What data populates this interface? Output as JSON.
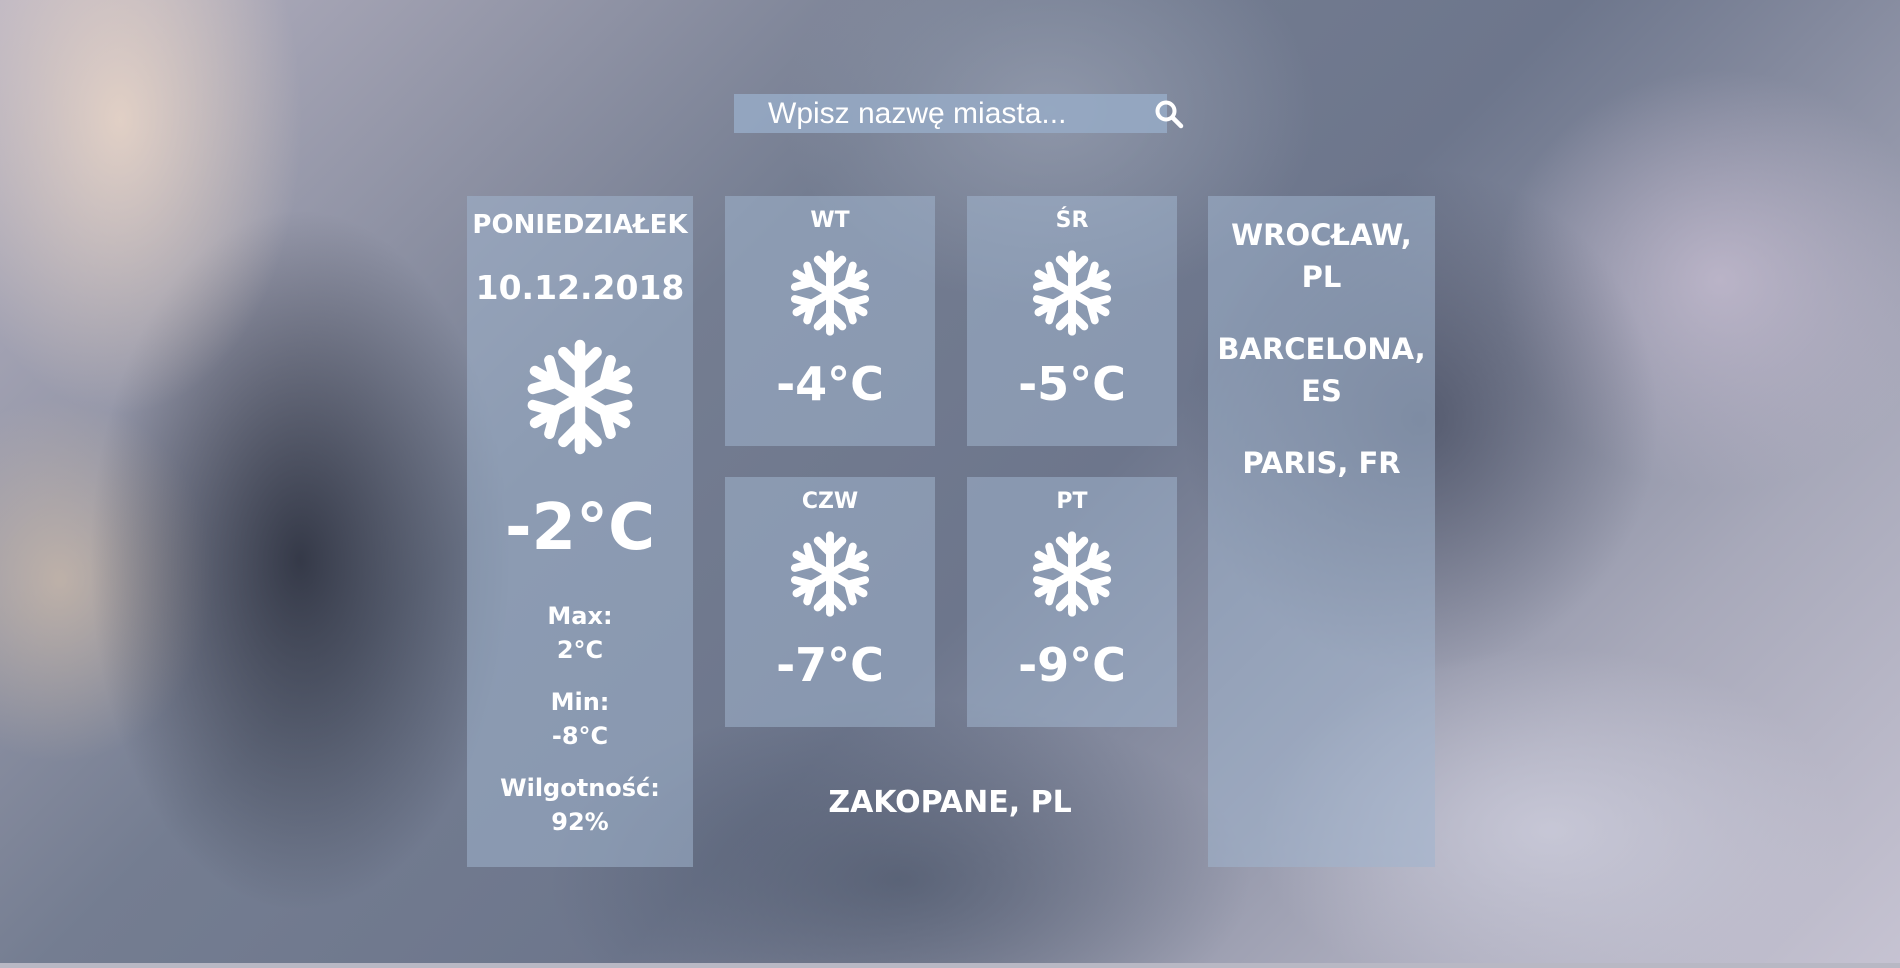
{
  "search": {
    "placeholder": "Wpisz nazwę miasta...",
    "button_icon": "search-icon"
  },
  "today": {
    "day": "PONIEDZIAŁEK",
    "date": "10.12.2018",
    "icon": "snowflake-icon",
    "temp": "-2°C",
    "max_label": "Max:",
    "max_value": "2°C",
    "min_label": "Min:",
    "min_value": "-8°C",
    "humidity_label": "Wilgotność:",
    "humidity_value": "92%"
  },
  "forecast": [
    {
      "day": "WT",
      "icon": "snowflake-icon",
      "temp": "-4°C"
    },
    {
      "day": "ŚR",
      "icon": "snowflake-icon",
      "temp": "-5°C"
    },
    {
      "day": "CZW",
      "icon": "snowflake-icon",
      "temp": "-7°C"
    },
    {
      "day": "PT",
      "icon": "snowflake-icon",
      "temp": "-9°C"
    }
  ],
  "location": "ZAKOPANE, PL",
  "saved_cities": [
    {
      "name": "WROCŁAW,",
      "country": "PL"
    },
    {
      "name": "BARCELONA,",
      "country": "ES"
    },
    {
      "name": "PARIS, FR",
      "country": ""
    }
  ],
  "colors": {
    "card_bg": "#a0b4cd",
    "text": "#ffffff"
  }
}
